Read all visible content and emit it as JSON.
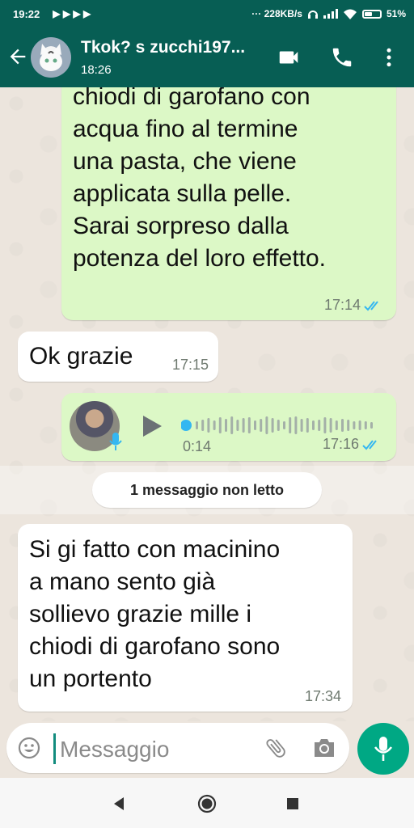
{
  "status_bar": {
    "time": "19:22",
    "notifications": "▶ ▶ ▶ ▶",
    "network_speed": "··· 228KB/s",
    "battery": "51%",
    "battery_level": 0.51
  },
  "header": {
    "contact_name": "Tkok? s zucchi197...",
    "last_seen": "18:26",
    "icons": [
      "back-arrow-icon",
      "avatar",
      "video-call-icon",
      "phone-icon",
      "more-vert-icon"
    ]
  },
  "messages": [
    {
      "direction": "outgoing",
      "text": "chiodi di garofano con\nacqua fino al termine\nuna pasta, che viene\napplicata sulla pelle.\nSarai sorpreso dalla\npotenza del loro effetto.",
      "time": "17:14",
      "status": "read"
    },
    {
      "direction": "incoming",
      "text": "Ok grazie",
      "time": "17:15"
    },
    {
      "direction": "outgoing",
      "type": "voice",
      "duration": "0:14",
      "time": "17:16",
      "status": "read"
    }
  ],
  "unread_banner": "1 messaggio non letto",
  "incoming_last": {
    "text": "Si gi fatto con macinino\na mano sento già\nsollievo grazie mille i\nchiodi di garofano sono\nun portento",
    "time": "17:34"
  },
  "composer": {
    "placeholder": "Messaggio",
    "value": ""
  },
  "colors": {
    "header": "#075e54",
    "outgoing_bubble": "#dcf8c6",
    "incoming_bubble": "#ffffff",
    "read_ticks": "#34b7f1",
    "send_button": "#00a884"
  }
}
